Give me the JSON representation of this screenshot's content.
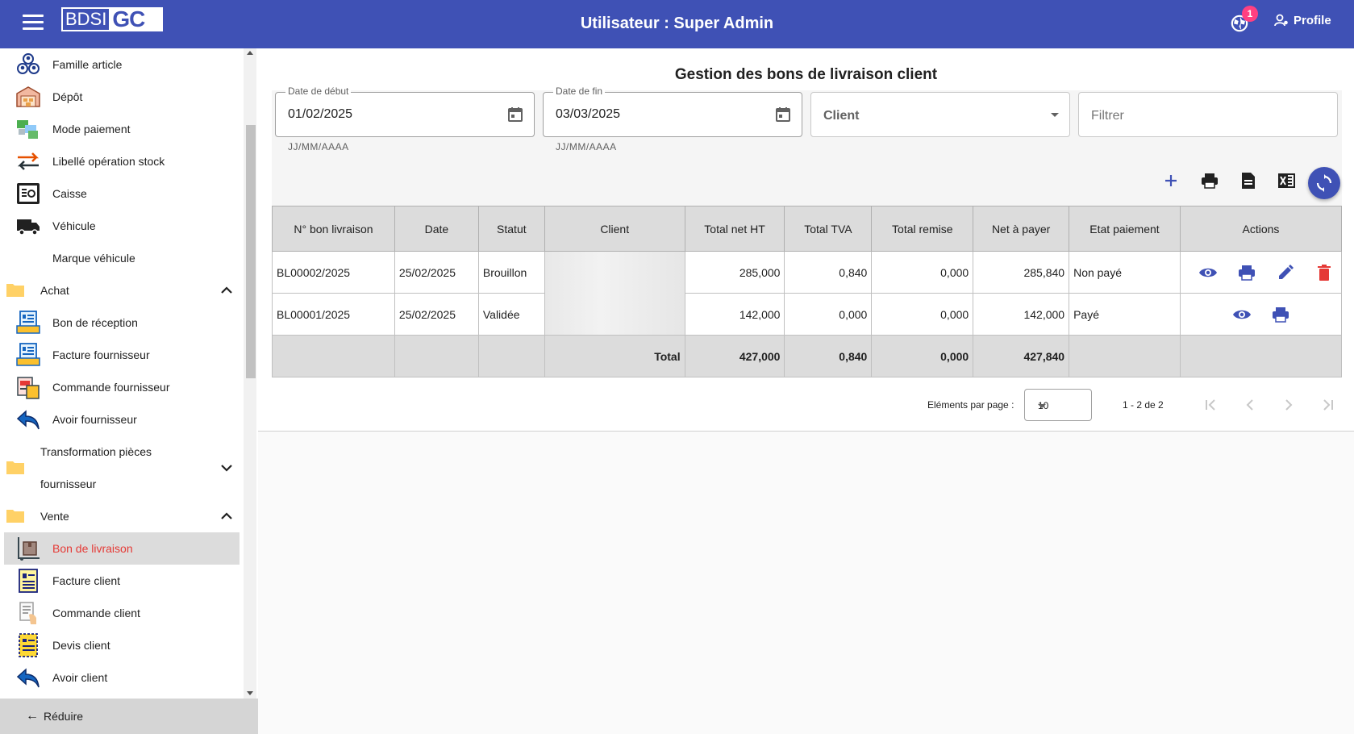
{
  "header": {
    "logo_left": "BDSI",
    "logo_right": "GC",
    "title": "Utilisateur : Super Admin",
    "notification_count": "1",
    "profile_label": "Profile"
  },
  "sidebar": {
    "items": [
      {
        "label": "Famille article",
        "icon": "family-icon"
      },
      {
        "label": "Dépôt",
        "icon": "warehouse-icon"
      },
      {
        "label": "Mode paiement",
        "icon": "payment-mode-icon"
      },
      {
        "label": "Libellé opération stock",
        "icon": "transfer-arrows-icon"
      },
      {
        "label": "Caisse",
        "icon": "safe-icon"
      },
      {
        "label": "Véhicule",
        "icon": "truck-icon"
      },
      {
        "label": "Marque véhicule",
        "icon": ""
      },
      {
        "label": "Achat",
        "icon": "folder-icon",
        "group": true,
        "expanded": true
      },
      {
        "label": "Bon de réception",
        "icon": "receipt-icon"
      },
      {
        "label": "Facture fournisseur",
        "icon": "supplier-invoice-icon"
      },
      {
        "label": "Commande fournisseur",
        "icon": "supplier-order-icon"
      },
      {
        "label": "Avoir fournisseur",
        "icon": "return-arrow-icon"
      },
      {
        "label": "Transformation pièces",
        "label2": "fournisseur",
        "icon": "folder-icon",
        "group": true,
        "expanded": false
      },
      {
        "label": "Vente",
        "icon": "folder-icon",
        "group": true,
        "expanded": true
      },
      {
        "label": "Bon de livraison",
        "icon": "delivery-cart-icon",
        "active": true
      },
      {
        "label": "Facture client",
        "icon": "client-invoice-icon"
      },
      {
        "label": "Commande client",
        "icon": "client-order-icon"
      },
      {
        "label": "Devis client",
        "icon": "quote-icon"
      },
      {
        "label": "Avoir client",
        "icon": "return-arrow-icon"
      }
    ],
    "reduce_label": "Réduire"
  },
  "main": {
    "title": "Gestion des bons de livraison client",
    "filters": {
      "start_label": "Date de début",
      "start_value": "01/02/2025",
      "start_hint": "JJ/MM/AAAA",
      "end_label": "Date de fin",
      "end_value": "03/03/2025",
      "end_hint": "JJ/MM/AAAA",
      "client_placeholder": "Client",
      "filter_placeholder": "Filtrer"
    },
    "table": {
      "headers": [
        "N° bon livraison",
        "Date",
        "Statut",
        "Client",
        "Total net HT",
        "Total TVA",
        "Total remise",
        "Net à payer",
        "Etat paiement",
        "Actions"
      ],
      "rows": [
        {
          "numero": "BL00002/2025",
          "date": "25/02/2025",
          "statut": "Brouillon",
          "client": "",
          "net_ht": "285,000",
          "tva": "0,840",
          "remise": "0,000",
          "net_payer": "285,840",
          "etat": "Non payé"
        },
        {
          "numero": "BL00001/2025",
          "date": "25/02/2025",
          "statut": "Validée",
          "client": "",
          "net_ht": "142,000",
          "tva": "0,000",
          "remise": "0,000",
          "net_payer": "142,000",
          "etat": "Payé"
        }
      ],
      "total": {
        "label": "Total",
        "net_ht": "427,000",
        "tva": "0,840",
        "remise": "0,000",
        "net_payer": "427,840"
      }
    },
    "pager": {
      "per_page_label": "Eléments par page :",
      "per_page_value": "10",
      "range": "1 - 2 de 2"
    }
  },
  "colors": {
    "primary": "#3f51b5",
    "active_text": "#e53935",
    "delete": "#e53935",
    "badge": "#ff4081"
  }
}
